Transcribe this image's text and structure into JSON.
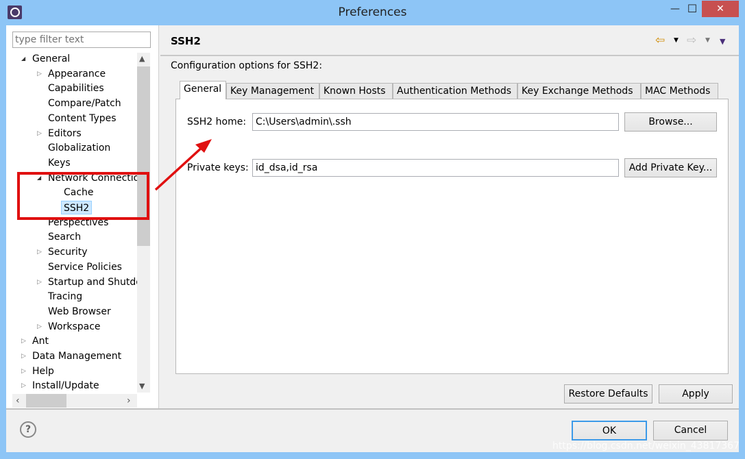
{
  "window": {
    "title": "Preferences",
    "minimize": "—",
    "maximize": "☐",
    "close": "✕"
  },
  "filter": {
    "placeholder": "type filter text"
  },
  "tree": [
    {
      "label": "General",
      "level": 0,
      "exp": "open"
    },
    {
      "label": "Appearance",
      "level": 1,
      "exp": "closed"
    },
    {
      "label": "Capabilities",
      "level": 1,
      "exp": ""
    },
    {
      "label": "Compare/Patch",
      "level": 1,
      "exp": ""
    },
    {
      "label": "Content Types",
      "level": 1,
      "exp": ""
    },
    {
      "label": "Editors",
      "level": 1,
      "exp": "closed"
    },
    {
      "label": "Globalization",
      "level": 1,
      "exp": ""
    },
    {
      "label": "Keys",
      "level": 1,
      "exp": ""
    },
    {
      "label": "Network Connections",
      "level": 1,
      "exp": "open"
    },
    {
      "label": "Cache",
      "level": 2,
      "exp": ""
    },
    {
      "label": "SSH2",
      "level": 2,
      "exp": "",
      "selected": true
    },
    {
      "label": "Perspectives",
      "level": 1,
      "exp": ""
    },
    {
      "label": "Search",
      "level": 1,
      "exp": ""
    },
    {
      "label": "Security",
      "level": 1,
      "exp": "closed"
    },
    {
      "label": "Service Policies",
      "level": 1,
      "exp": ""
    },
    {
      "label": "Startup and Shutdown",
      "level": 1,
      "exp": "closed"
    },
    {
      "label": "Tracing",
      "level": 1,
      "exp": ""
    },
    {
      "label": "Web Browser",
      "level": 1,
      "exp": ""
    },
    {
      "label": "Workspace",
      "level": 1,
      "exp": "closed"
    },
    {
      "label": "Ant",
      "level": 0,
      "exp": "closed"
    },
    {
      "label": "Data Management",
      "level": 0,
      "exp": "closed"
    },
    {
      "label": "Help",
      "level": 0,
      "exp": "closed"
    },
    {
      "label": "Install/Update",
      "level": 0,
      "exp": "closed"
    }
  ],
  "page": {
    "title": "SSH2",
    "description": "Configuration options for SSH2:"
  },
  "tabs": [
    "General",
    "Key Management",
    "Known Hosts",
    "Authentication Methods",
    "Key Exchange Methods",
    "MAC Methods"
  ],
  "general": {
    "ssh2_home_label": "SSH2 home:",
    "ssh2_home_value": "C:\\Users\\admin\\.ssh",
    "browse": "Browse...",
    "private_keys_label": "Private keys:",
    "private_keys_value": "id_dsa,id_rsa",
    "add_key": "Add Private Key..."
  },
  "buttons": {
    "restore": "Restore Defaults",
    "apply": "Apply",
    "ok": "OK",
    "cancel": "Cancel",
    "help": "?"
  },
  "watermark": "https://blog.csdn.net/weixin_43817367",
  "colors": {
    "titlebar": "#8dc5f6",
    "close": "#c75050",
    "annotation": "#e01010",
    "selection": "#cde8ff"
  }
}
